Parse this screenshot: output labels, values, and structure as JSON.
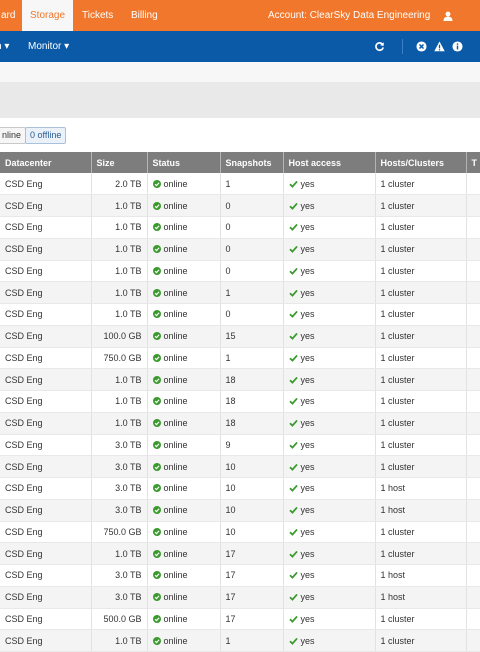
{
  "topbar": {
    "tabs": [
      {
        "label": "ard",
        "active": false
      },
      {
        "label": "Storage",
        "active": true
      },
      {
        "label": "Tickets",
        "active": false
      },
      {
        "label": "Billing",
        "active": false
      }
    ],
    "account": "Account: ClearSky Data Engineering",
    "user_icon": "user-icon",
    "brand_color": "#f0772b"
  },
  "navbar": {
    "left_menu": "n ▾",
    "monitor_menu": "Monitor ▾",
    "icons": [
      "refresh-icon",
      "close-circle-icon",
      "warning-icon",
      "info-icon"
    ],
    "color": "#0b5aa8"
  },
  "filters": {
    "online": "nline",
    "offline": "0 offline"
  },
  "table": {
    "headers": [
      "Datacenter",
      "Size",
      "Status",
      "Snapshots",
      "Host access",
      "Hosts/Clusters",
      "T"
    ],
    "rows": [
      [
        "CSD Eng",
        "2.0 TB",
        "online",
        "1",
        "yes",
        "1 cluster"
      ],
      [
        "CSD Eng",
        "1.0 TB",
        "online",
        "0",
        "yes",
        "1 cluster"
      ],
      [
        "CSD Eng",
        "1.0 TB",
        "online",
        "0",
        "yes",
        "1 cluster"
      ],
      [
        "CSD Eng",
        "1.0 TB",
        "online",
        "0",
        "yes",
        "1 cluster"
      ],
      [
        "CSD Eng",
        "1.0 TB",
        "online",
        "0",
        "yes",
        "1 cluster"
      ],
      [
        "CSD Eng",
        "1.0 TB",
        "online",
        "1",
        "yes",
        "1 cluster"
      ],
      [
        "CSD Eng",
        "1.0 TB",
        "online",
        "0",
        "yes",
        "1 cluster"
      ],
      [
        "CSD Eng",
        "100.0 GB",
        "online",
        "15",
        "yes",
        "1 cluster"
      ],
      [
        "CSD Eng",
        "750.0 GB",
        "online",
        "1",
        "yes",
        "1 cluster"
      ],
      [
        "CSD Eng",
        "1.0 TB",
        "online",
        "18",
        "yes",
        "1 cluster"
      ],
      [
        "CSD Eng",
        "1.0 TB",
        "online",
        "18",
        "yes",
        "1 cluster"
      ],
      [
        "CSD Eng",
        "1.0 TB",
        "online",
        "18",
        "yes",
        "1 cluster"
      ],
      [
        "CSD Eng",
        "3.0 TB",
        "online",
        "9",
        "yes",
        "1 cluster"
      ],
      [
        "CSD Eng",
        "3.0 TB",
        "online",
        "10",
        "yes",
        "1 cluster"
      ],
      [
        "CSD Eng",
        "3.0 TB",
        "online",
        "10",
        "yes",
        "1 host"
      ],
      [
        "CSD Eng",
        "3.0 TB",
        "online",
        "10",
        "yes",
        "1 host"
      ],
      [
        "CSD Eng",
        "750.0 GB",
        "online",
        "10",
        "yes",
        "1 cluster"
      ],
      [
        "CSD Eng",
        "1.0 TB",
        "online",
        "17",
        "yes",
        "1 cluster"
      ],
      [
        "CSD Eng",
        "3.0 TB",
        "online",
        "17",
        "yes",
        "1 host"
      ],
      [
        "CSD Eng",
        "3.0 TB",
        "online",
        "17",
        "yes",
        "1 host"
      ],
      [
        "CSD Eng",
        "500.0 GB",
        "online",
        "17",
        "yes",
        "1 cluster"
      ],
      [
        "CSD Eng",
        "1.0 TB",
        "online",
        "1",
        "yes",
        "1 cluster"
      ]
    ],
    "status_color": "#3a9a2e",
    "header_color": "#7d7d7d"
  }
}
